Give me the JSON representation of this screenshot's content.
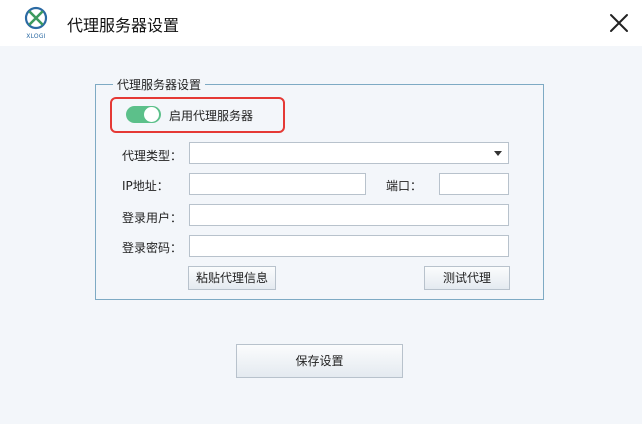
{
  "window": {
    "title": "代理服务器设置",
    "logo_text": "XLOGI",
    "close_icon": "close-icon"
  },
  "proxy_group": {
    "legend": "代理服务器设置",
    "enable_proxy": {
      "label": "启用代理服务器",
      "on": true,
      "color": "#5cc08a"
    },
    "highlight_color": "#e53935",
    "type": {
      "label": "代理类型：",
      "value": ""
    },
    "ip": {
      "label": "IP地址：",
      "value": ""
    },
    "port": {
      "label": "端口：",
      "value": ""
    },
    "user": {
      "label": "登录用户：",
      "value": ""
    },
    "password": {
      "label": "登录密码：",
      "value": ""
    },
    "paste_button": "粘贴代理信息",
    "test_button": "测试代理"
  },
  "save_button": "保存设置"
}
